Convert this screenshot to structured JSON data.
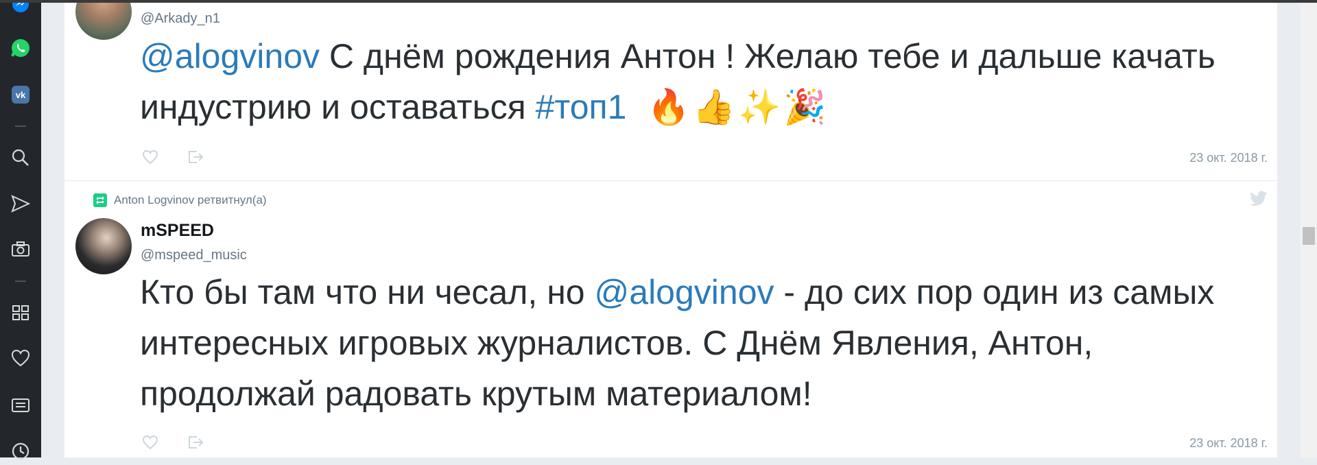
{
  "sidebar": {
    "items": [
      {
        "name": "messenger-icon"
      },
      {
        "name": "whatsapp-icon"
      },
      {
        "name": "vk-icon"
      },
      {
        "name": "search-icon"
      },
      {
        "name": "send-icon"
      },
      {
        "name": "camera-icon"
      },
      {
        "name": "apps-grid-icon"
      },
      {
        "name": "heart-icon"
      },
      {
        "name": "news-icon"
      },
      {
        "name": "history-icon"
      }
    ],
    "colors": {
      "whatsapp": "#25d366",
      "vk": "#4a76a8",
      "messenger": "#0084ff",
      "icon": "#d7dadd"
    }
  },
  "tweets": [
    {
      "handle": "@Arkady_n1",
      "text_mention": "@alogvinov",
      "text_part1": " С днём рождения Антон ! Желаю тебе и дальше качать индустрию и оставаться ",
      "hashtag": "#топ1",
      "emojis": "🔥👍✨🎉",
      "date": "23 окт. 2018 г."
    },
    {
      "retweet_label": "Anton Logvinov ретвитнул(а)",
      "name": "mSPEED",
      "handle": "@mspeed_music",
      "text_part1": "Кто бы там что ни чесал, но ",
      "text_mention": "@alogvinov",
      "text_part2": " - до сих пор один из самых интересных игровых журналистов. С Днём Явления, Антон, продолжай радовать крутым материалом!",
      "date": "23 окт. 2018 г."
    }
  ],
  "colors": {
    "link": "#2b7bb9",
    "retweet": "#19cf86",
    "muted": "#8899a6"
  }
}
